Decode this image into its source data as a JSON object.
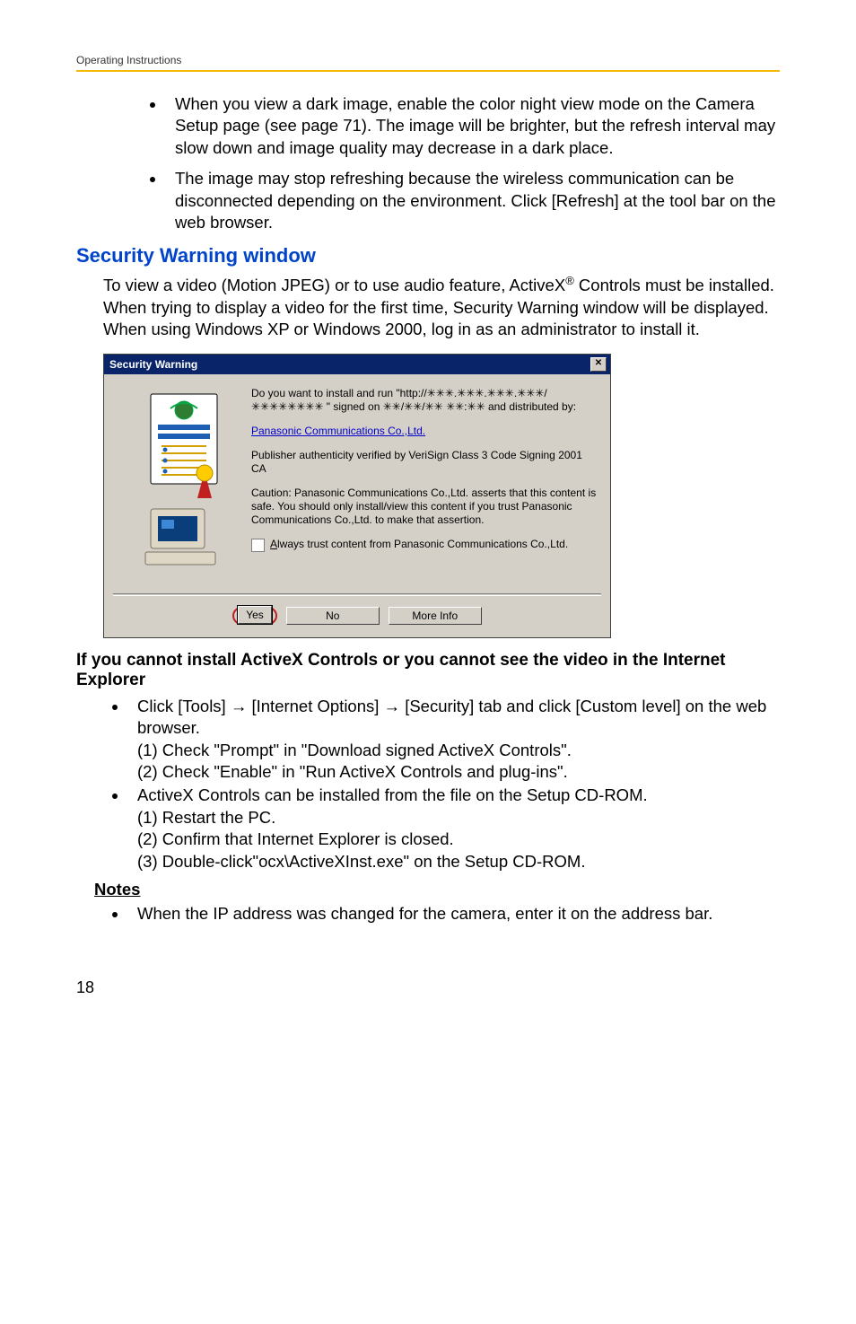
{
  "header": {
    "text": "Operating Instructions"
  },
  "bullets_top": [
    "When you view a dark image, enable the color night view mode on the Camera Setup page (see page 71). The image will be brighter, but the refresh interval may slow down and image quality may decrease in a dark place.",
    "The image may stop refreshing because the wireless communication can be disconnected depending on the environment. Click [Refresh] at the tool bar on the web browser."
  ],
  "section_title": "Security Warning window",
  "section_para_pre": "To view a video (Motion JPEG) or to use audio feature, ActiveX",
  "section_para_tm": "®",
  "section_para_post": " Controls must be installed. When trying to display a video for the first time, Security Warning window will be displayed. When using Windows XP or Windows 2000, log in as an administrator to install it.",
  "dialog": {
    "title": "Security Warning",
    "close_glyph": "✕",
    "p1": "Do you want to install and run \"http://✳✳✳.✳✳✳.✳✳✳.✳✳✳/✳✳✳✳✳✳✳✳ \" signed on ✳✳/✳✳/✳✳ ✳✳:✳✳ and distributed by:",
    "link": "Panasonic Communications Co.,Ltd.",
    "p2": "Publisher authenticity verified by VeriSign Class 3 Code Signing 2001 CA",
    "p3": "Caution: Panasonic Communications Co.,Ltd. asserts that this content is safe.  You should only install/view this content if you trust Panasonic Communications Co.,Ltd. to make that assertion.",
    "check_pre": "A",
    "check_post": "lways trust content from Panasonic Communications Co.,Ltd.",
    "btn_yes": "Yes",
    "btn_no": "No",
    "btn_more": "More Info"
  },
  "subhead": "If you cannot install ActiveX Controls or you cannot see the video in the Internet Explorer",
  "step1_pre": "Click [Tools]",
  "step1_mid1": "[Internet Options]",
  "step1_mid2": "[Security] tab and click [Custom level] on the web browser.",
  "arrow": "→",
  "step1_sub1": "(1) Check \"Prompt\" in \"Download signed ActiveX Controls\".",
  "step1_sub2": "(2) Check \"Enable\" in \"Run ActiveX Controls and plug-ins\".",
  "step2": "ActiveX Controls can be installed from the file on the Setup CD-ROM.",
  "step2_sub1": "(1) Restart the PC.",
  "step2_sub2": "(2) Confirm that Internet Explorer is closed.",
  "step2_sub3": "(3) Double-click\"ocx\\ActiveXInst.exe\" on the Setup CD-ROM.",
  "notes_label": "Notes",
  "note1": "When the IP address was changed for the camera, enter it on the address bar.",
  "page_number": "18"
}
